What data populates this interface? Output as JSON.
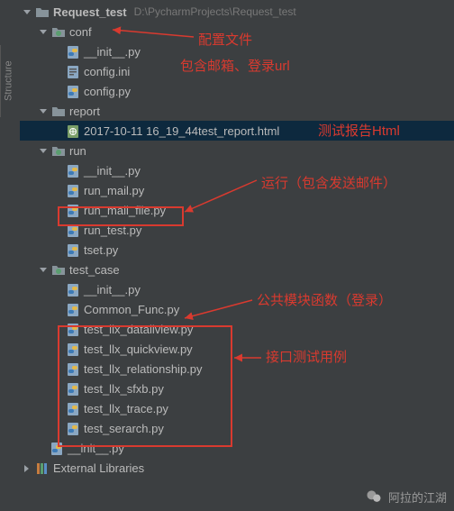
{
  "colors": {
    "accent_red": "#d93a2f",
    "selection": "#0d293e"
  },
  "project": {
    "name": "Request_test",
    "path": "D:\\PycharmProjects\\Request_test"
  },
  "tree": {
    "conf": {
      "label": "conf",
      "children": {
        "init": "__init__.py",
        "configini": "config.ini",
        "configpy": "config.py"
      }
    },
    "report": {
      "label": "report",
      "children": {
        "html": "2017-10-11 16_19_44test_report.html"
      }
    },
    "run": {
      "label": "run",
      "children": {
        "init": "__init__.py",
        "runmail": "run_mail.py",
        "runmailfile": "run_mail_file.py",
        "runtest": "run_test.py",
        "tset": "tset.py"
      }
    },
    "test_case": {
      "label": "test_case",
      "children": {
        "init": "__init__.py",
        "common": "Common_Func.py",
        "datail": "test_llx_datailview.py",
        "quick": "test_llx_quickview.py",
        "rel": "test_llx_relationship.py",
        "sfxb": "test_llx_sfxb.py",
        "trace": "test_llx_trace.py",
        "search": "test_serarch.py"
      }
    },
    "root_init": "__init__.py",
    "ext_libs": "External Libraries"
  },
  "annotations": {
    "conf_line1": "配置文件",
    "conf_line2": "包含邮箱、登录url",
    "report": "测试报告Html",
    "run": "运行（包含发送邮件）",
    "common": "公共模块函数（登录）",
    "tests": "接口测试用例"
  },
  "sidebar_tab": "Structure",
  "watermark": "阿拉的江湖"
}
